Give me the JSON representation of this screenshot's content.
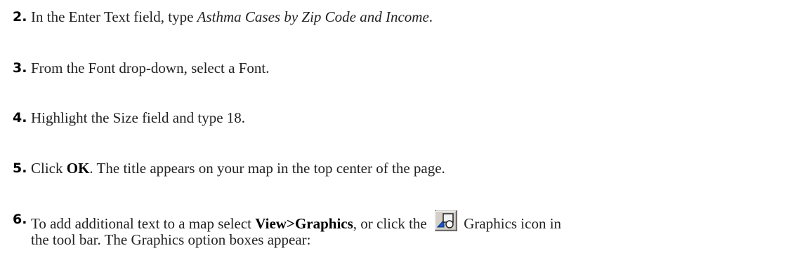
{
  "steps": [
    {
      "number": "2.",
      "before": "In the Enter Text field, type ",
      "italic": "Asthma Cases by Zip Code and Income",
      "after": "."
    },
    {
      "number": "3.",
      "text": "From the Font drop-down, select a Font."
    },
    {
      "number": "4.",
      "text": "Highlight the Size field and type 18."
    },
    {
      "number": "5.",
      "before": "Click ",
      "bold": "OK",
      "after": ". The title appears on your map in the top center of the page."
    },
    {
      "number": "6.",
      "before": "To add additional text to a map select ",
      "bold": "View>Graphics",
      "middle": ", or click the ",
      "icon_name": "graphics-icon",
      "after": " Graphics icon in",
      "line2": "the tool bar. The Graphics option boxes appear:"
    }
  ]
}
